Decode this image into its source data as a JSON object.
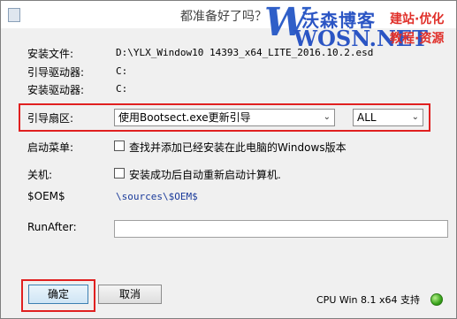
{
  "window": {
    "title": "都准备好了吗？"
  },
  "watermark": {
    "line1": "沃森博客",
    "line2": "WOSN.NET",
    "tag1": "建站·优化",
    "tag2": "教程·资源"
  },
  "fields": {
    "install_file_label": "安装文件:",
    "install_file_value": "D:\\YLX_Window10 14393_x64_LITE_2016.10.2.esd",
    "boot_drive_label": "引导驱动器:",
    "boot_drive_value": "C:",
    "install_drive_label": "安装驱动器:",
    "install_drive_value": "C:"
  },
  "boot_sector": {
    "label": "引导扇区:",
    "method_selected": "使用Bootsect.exe更新引导",
    "scope_selected": "ALL"
  },
  "boot_menu": {
    "label": "启动菜单:",
    "checkbox_label": "查找并添加已经安装在此电脑的Windows版本",
    "checked": false
  },
  "shutdown": {
    "label": "关机:",
    "checkbox_label": "安装成功后自动重新启动计算机.",
    "checked": false
  },
  "oem": {
    "label": "$OEM$",
    "value": "\\sources\\$OEM$"
  },
  "runafter": {
    "label": "RunAfter:",
    "value": ""
  },
  "buttons": {
    "ok": "确定",
    "cancel": "取消"
  },
  "status": {
    "text": "CPU Win 8.1 x64 支持",
    "color": "#3aa51d"
  },
  "colors": {
    "highlight_box": "#e02020",
    "oem_link": "#1a3a9a"
  }
}
